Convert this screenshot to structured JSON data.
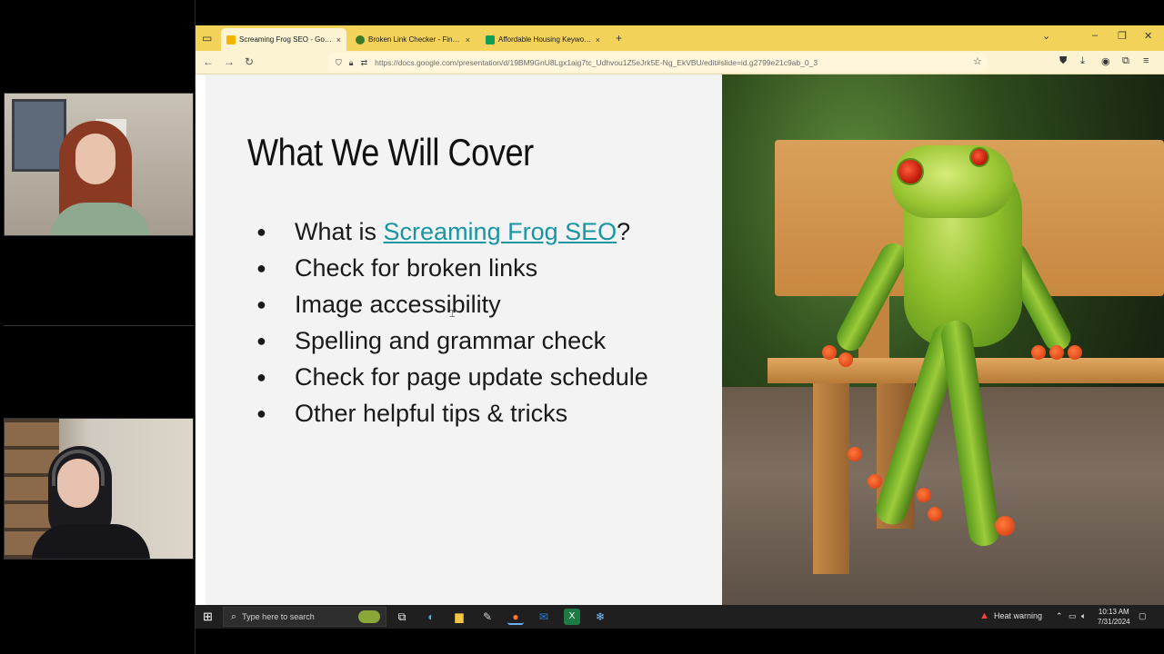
{
  "browser": {
    "tabs": [
      {
        "label": "Screaming Frog SEO - Google Sl",
        "active": true,
        "icon": "google-slides-icon",
        "color": "#f4b400"
      },
      {
        "label": "Broken Link Checker - Find Bro",
        "active": false,
        "icon": "broken-link-checker-icon",
        "color": "#3c7a2a"
      },
      {
        "label": "Affordable Housing Keyword L",
        "active": false,
        "icon": "google-sheets-icon",
        "color": "#0f9d58"
      }
    ],
    "close_glyph": "×",
    "new_tab_glyph": "+",
    "url": "https://docs.google.com/presentation/d/19BM9GnU8Lgx1aig7tc_Udhvou1Z5eJrk5E-Ng_EkVBU/edit#slide=id.g2799e21c9ab_0_3",
    "accent_color": "#f3d25a"
  },
  "slide": {
    "title": "What We Will Cover",
    "bullets": {
      "b1_prefix": "What is ",
      "b1_link": "Screaming Frog SEO",
      "b1_suffix": "?",
      "b2": "Check for broken links",
      "b3": "Image accessibility",
      "b4": "Spelling and grammar check",
      "b5": "Check for page update schedule",
      "b6": "Other helpful tips & tricks"
    },
    "link_color": "#1795a3"
  },
  "taskbar": {
    "search_placeholder": "Type here to search",
    "heat_warning": "Heat warning",
    "time": "10:13 AM",
    "date": "7/31/2024"
  }
}
